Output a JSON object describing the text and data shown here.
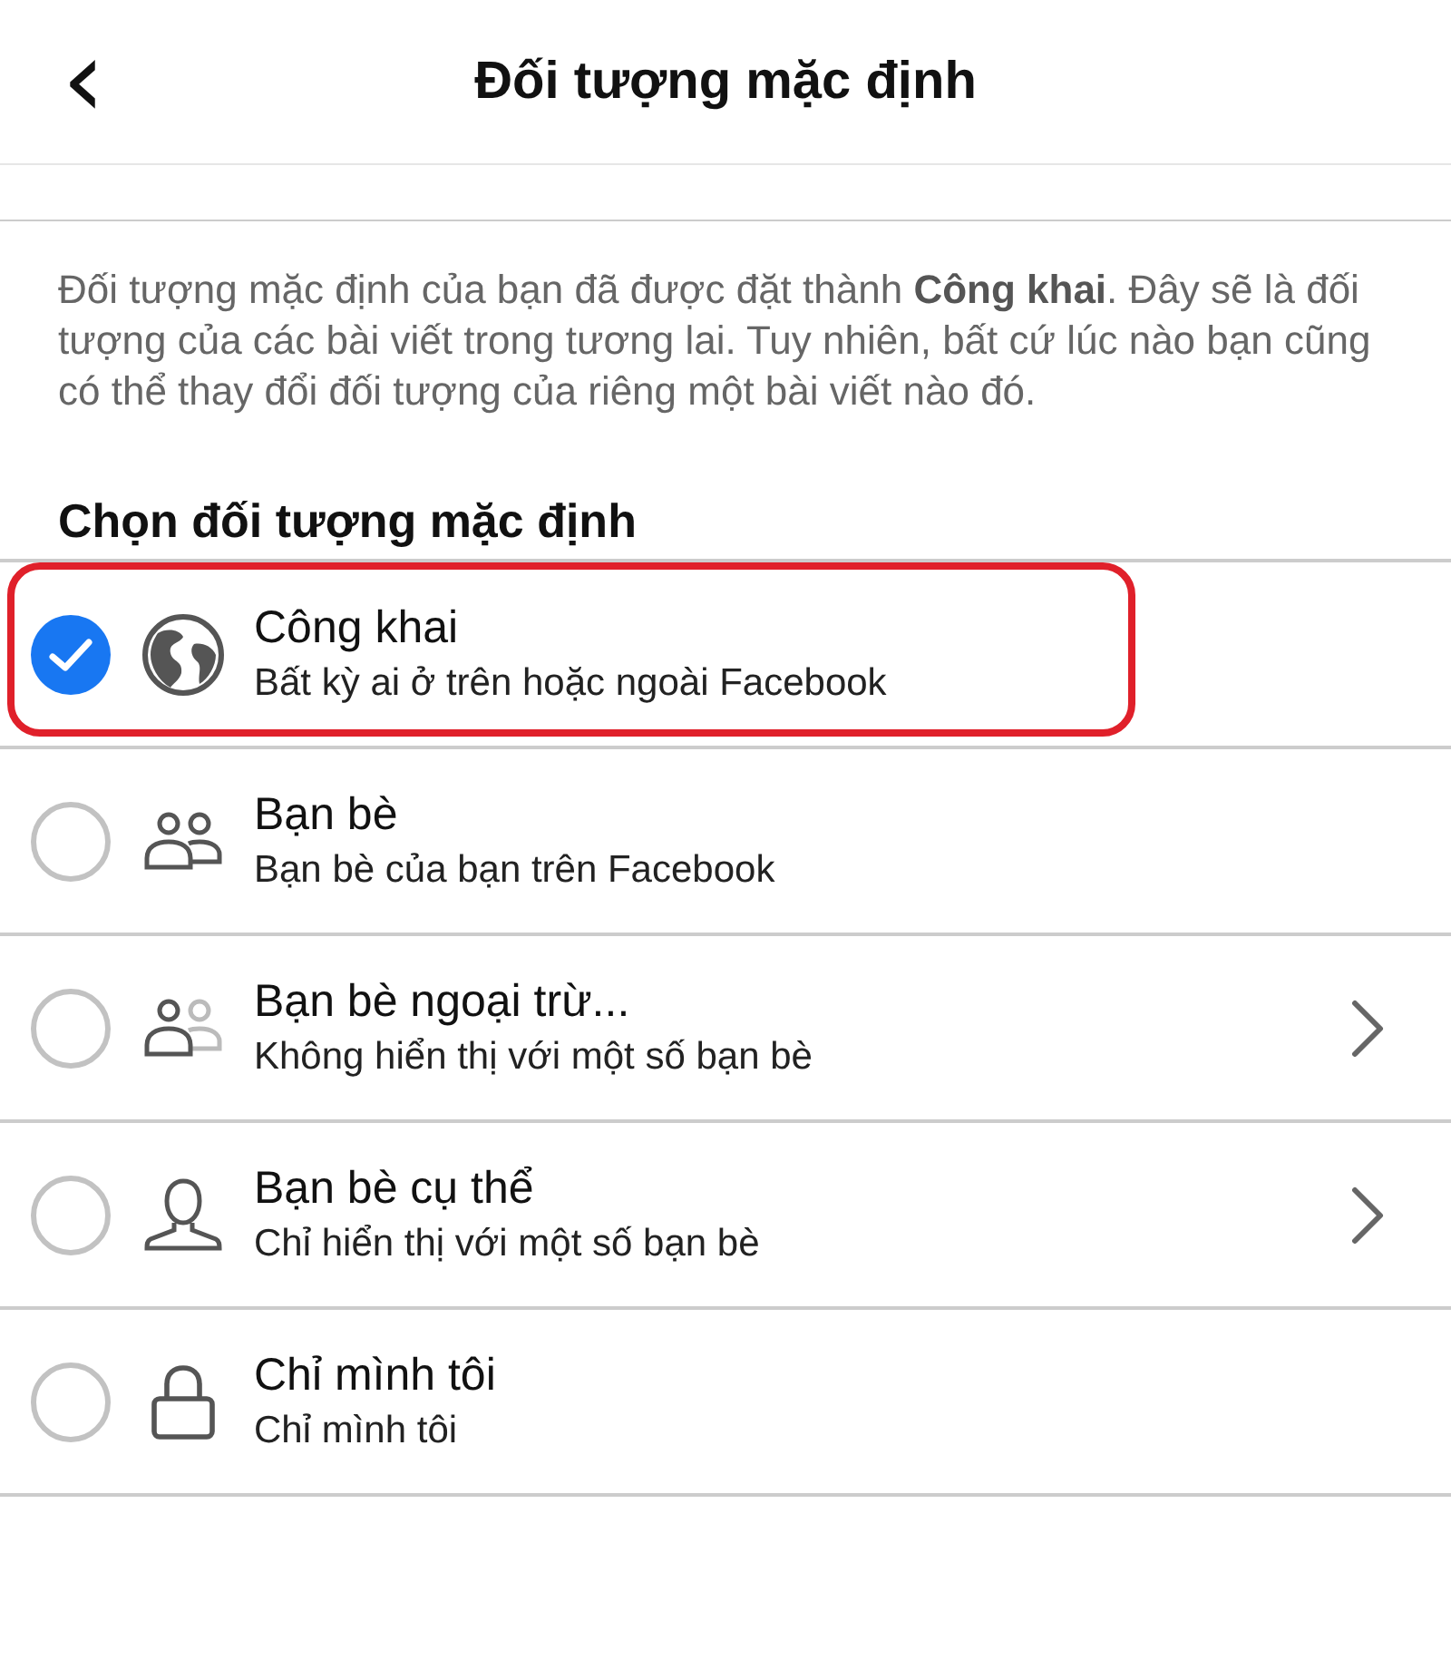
{
  "header": {
    "back_icon": "‹",
    "title": "Đối tượng mặc định"
  },
  "description": "Đối tượng mặc định của bạn đã được đặt thành **Công khai**. Đây sẽ là đối tượng của các bài viết trong tương lai. Tuy nhiên, bất cứ lúc nào bạn cũng có thể thay đổi đối tượng của riêng một bài viết nào đó.",
  "section_title": "Chọn đối tượng mặc định",
  "options": [
    {
      "kind": "globe",
      "title": "Công khai",
      "subtitle": "Bất kỳ ai ở trên hoặc ngoài Facebook",
      "selected": true,
      "highlighted": true,
      "chevron": false
    },
    {
      "kind": "friends",
      "title": "Bạn bè",
      "subtitle": "Bạn bè của bạn trên Facebook",
      "selected": false,
      "highlighted": false,
      "chevron": false
    },
    {
      "kind": "friends-except",
      "title": "Bạn bè ngoại trừ...",
      "subtitle": "Không hiển thị với một số bạn bè",
      "selected": false,
      "highlighted": false,
      "chevron": true
    },
    {
      "kind": "person",
      "title": "Bạn bè cụ thể",
      "subtitle": "Chỉ hiển thị với một số bạn bè",
      "selected": false,
      "highlighted": false,
      "chevron": true
    },
    {
      "kind": "lock",
      "title": "Chỉ mình tôi",
      "subtitle": "Chỉ mình tôi",
      "selected": false,
      "highlighted": false,
      "chevron": false
    }
  ]
}
